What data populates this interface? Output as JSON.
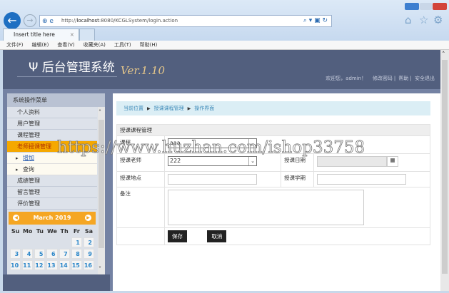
{
  "browser": {
    "url_prefix": "http://",
    "url_host": "localhost",
    "url_rest": ":8080/KCGLSystem/login.action",
    "tab_title": "Insert title here",
    "tab_close": "×",
    "menu": [
      "文件(F)",
      "编辑(E)",
      "查看(V)",
      "收藏夹(A)",
      "工具(T)",
      "帮助(H)"
    ]
  },
  "header": {
    "logo_icon": "Ψ",
    "title": "后台管理系统",
    "version": "Ver.1.10",
    "welcome": "欢迎您，admin！",
    "change_password": "修改密码",
    "help": "帮助",
    "logout": "安全退出",
    "sep": "|"
  },
  "sidebar": {
    "title": "系统操作菜单",
    "items": [
      "个人资料",
      "用户管理",
      "课程管理",
      "老师授课管理"
    ],
    "sub": [
      "增加",
      "查询"
    ],
    "items2": [
      "成绩管理",
      "留言管理",
      "评价管理"
    ]
  },
  "calendar": {
    "month": "March 2019",
    "days": [
      "Su",
      "Mo",
      "Tu",
      "We",
      "Th",
      "Fr",
      "Sa"
    ],
    "rows": [
      [
        "",
        "",
        "",
        "",
        "",
        "1",
        "2"
      ],
      [
        "3",
        "4",
        "5",
        "6",
        "7",
        "8",
        "9"
      ],
      [
        "10",
        "11",
        "12",
        "13",
        "14",
        "15",
        "16"
      ]
    ]
  },
  "main": {
    "breadcrumb": [
      "当前位置",
      "授课课程管理",
      "操作界面"
    ],
    "section": "授课课程管理",
    "fields": {
      "course_label": "课程",
      "course_value": "aaa",
      "teacher_label": "授课老师",
      "teacher_value": "222",
      "date_label": "授课日期",
      "place_label": "授课地点",
      "term_label": "授课学期",
      "note_label": "备注"
    },
    "save": "保存",
    "cancel": "取消"
  },
  "watermark": "https://www.huzhan.com/ishop33758"
}
